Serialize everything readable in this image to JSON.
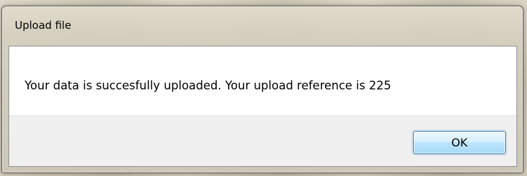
{
  "dialog": {
    "title": "Upload file",
    "message": "Your data is succesfully uploaded.  Your upload reference is 225",
    "ok_label": "OK"
  },
  "colors": {
    "button_border": "#3c7fb1",
    "button_fill": "#bee6fd",
    "client_background": "#f0f0f0",
    "message_background": "#ffffff"
  }
}
